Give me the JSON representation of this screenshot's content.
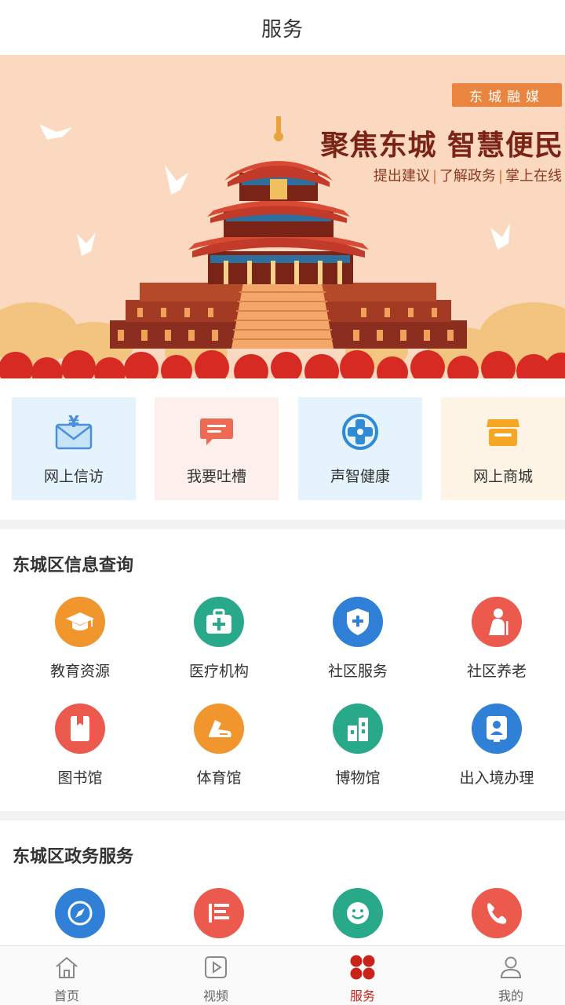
{
  "header": {
    "title": "服务"
  },
  "banner": {
    "brand": "东城融媒",
    "headline": "聚焦东城 智慧便民",
    "subtitle": [
      "提出建议",
      "了解政务",
      "掌上在线"
    ]
  },
  "quick_links": [
    {
      "label": "网上信访",
      "icon": "mail-yen-icon",
      "bg": "#e4f3fc"
    },
    {
      "label": "我要吐槽",
      "icon": "chat-bubble-icon",
      "bg": "#fdf0ec"
    },
    {
      "label": "声智健康",
      "icon": "health-cross-icon",
      "bg": "#e4f3fc"
    },
    {
      "label": "网上商城",
      "icon": "shop-icon",
      "bg": "#fdf4e6"
    }
  ],
  "info_section": {
    "title": "东城区信息查询",
    "items": [
      {
        "label": "教育资源",
        "icon": "graduation-cap-icon",
        "color": "#f0962d"
      },
      {
        "label": "医疗机构",
        "icon": "medical-kit-icon",
        "color": "#27a98a"
      },
      {
        "label": "社区服务",
        "icon": "shield-plus-icon",
        "color": "#2f80d6"
      },
      {
        "label": "社区养老",
        "icon": "elderly-icon",
        "color": "#ec5a4d"
      },
      {
        "label": "图书馆",
        "icon": "book-icon",
        "color": "#ec5a4d"
      },
      {
        "label": "体育馆",
        "icon": "sneaker-icon",
        "color": "#f0962d"
      },
      {
        "label": "博物馆",
        "icon": "building-icon",
        "color": "#27a98a"
      },
      {
        "label": "出入境办理",
        "icon": "id-card-icon",
        "color": "#2f80d6"
      }
    ]
  },
  "gov_section": {
    "title": "东城区政务服务",
    "items": [
      {
        "icon": "compass-icon",
        "color": "#2f80d6"
      },
      {
        "icon": "list-icon",
        "color": "#ec5a4d"
      },
      {
        "icon": "smile-icon",
        "color": "#27a98a"
      },
      {
        "icon": "phone-icon",
        "color": "#ec5a4d"
      }
    ]
  },
  "tabbar": {
    "active_color": "#c8241c",
    "tabs": [
      {
        "label": "首页",
        "icon": "home-icon"
      },
      {
        "label": "视频",
        "icon": "video-icon"
      },
      {
        "label": "服务",
        "icon": "services-icon",
        "active": true
      },
      {
        "label": "我的",
        "icon": "user-icon"
      }
    ]
  }
}
